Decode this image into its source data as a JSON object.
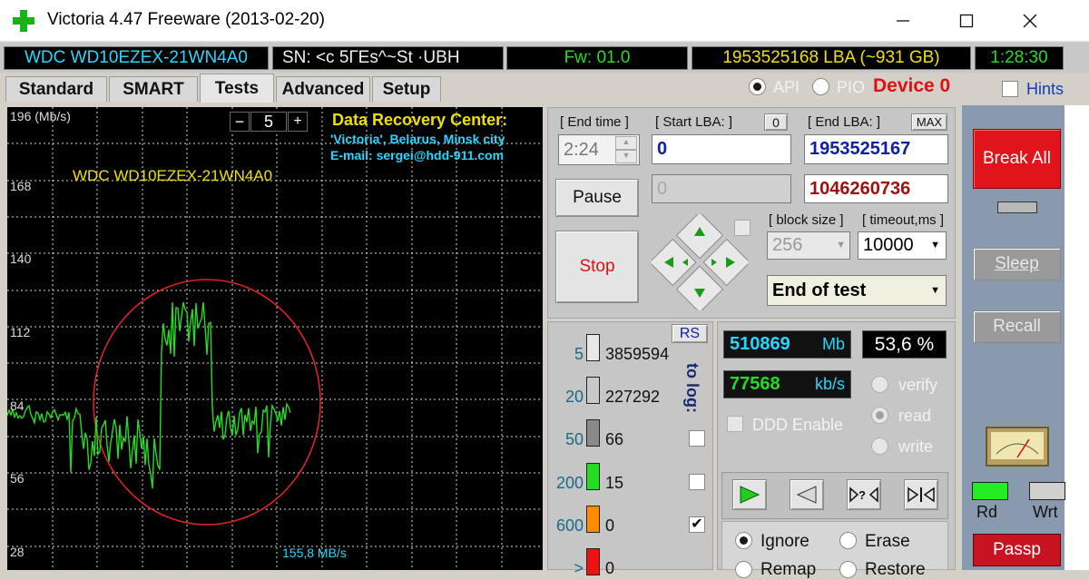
{
  "window": {
    "title": "Victoria 4.47  Freeware (2013-02-20)",
    "controls": [
      "minimize",
      "maximize",
      "close"
    ]
  },
  "info_bar": {
    "model": "WDC WD10EZEX-21WN4A0",
    "serial": "SN: <c  5ГEs^~St    ·UBH",
    "firmware": "Fw: 01.0",
    "lba": "1953525168 LBA (~931 GB)",
    "timer": "1:28:30"
  },
  "tabs": [
    {
      "label": "Standard",
      "active": false
    },
    {
      "label": "SMART",
      "active": false
    },
    {
      "label": "Tests",
      "active": true
    },
    {
      "label": "Advanced",
      "active": false
    },
    {
      "label": "Setup",
      "active": false
    }
  ],
  "mode": {
    "api_label": "API",
    "pio_label": "PIO",
    "selected": "API",
    "device_label": "Device 0",
    "hints_label": "Hints"
  },
  "graph": {
    "y_ticks": [
      "196 (Mb/s)",
      "168",
      "140",
      "112",
      "84",
      "56",
      "28"
    ],
    "scale_minus": "−",
    "scale_value": "5",
    "scale_plus": "+",
    "drive_label": "WDC WD10EZEX-21WN4A0",
    "recovery_title": "Data Recovery Center:",
    "recovery_line1": "'Victoria', Belarus, Minsk city",
    "recovery_line2": "E-mail: sergei@hdd-911.com",
    "speed_readout": "155,8 MB/s",
    "colors": {
      "background": "#000000",
      "grid": "#d8d8d8",
      "trace": "#22dd22",
      "ellipse": "#dd2222"
    }
  },
  "test_controls": {
    "end_time_label": "[ End time ]",
    "end_time_value": "2:24",
    "start_lba_label": "[ Start LBA: ]",
    "start_lba_zero_btn": "0",
    "start_lba_value": "0",
    "end_lba_label": "[ End LBA: ]",
    "end_lba_max_btn": "MAX",
    "end_lba_value": "1953525167",
    "current_lba_disabled": "0",
    "current_lba_value": "1046260736",
    "pause_label": "Pause",
    "stop_label": "Stop",
    "block_size_label": "[ block size ]",
    "block_size_value": "256",
    "timeout_label": "[ timeout,ms ]",
    "timeout_value": "10000",
    "end_action_value": "End of test"
  },
  "stats": {
    "rs_label": "RS",
    "to_log_label": "to log:",
    "rows": [
      {
        "threshold": "5",
        "count": "3859594",
        "color": "#e8e8e8",
        "log": false,
        "has_checkbox": false
      },
      {
        "threshold": "20",
        "count": "227292",
        "color": "#c8c8c8",
        "log": false,
        "has_checkbox": false
      },
      {
        "threshold": "50",
        "count": "66",
        "color": "#8a8a8a",
        "log": false,
        "has_checkbox": true
      },
      {
        "threshold": "200",
        "count": "15",
        "color": "#22dd22",
        "log": false,
        "has_checkbox": true
      },
      {
        "threshold": "600",
        "count": "0",
        "color": "#ff8c00",
        "log": true,
        "has_checkbox": true
      },
      {
        "threshold": ">",
        "count": "0",
        "color": "#ee1111",
        "log": false,
        "has_checkbox": false
      }
    ]
  },
  "progress": {
    "mb_value": "510869",
    "mb_unit": "Mb",
    "percent": "53,6 %",
    "speed_value": "77568",
    "speed_unit": "kb/s",
    "ddd_label": "DDD Enable",
    "verify_label": "verify",
    "read_label": "read",
    "write_label": "write",
    "selected_mode": "read"
  },
  "actions": {
    "ignore_label": "Ignore",
    "erase_label": "Erase",
    "remap_label": "Remap",
    "restore_label": "Restore",
    "selected_action": "Ignore"
  },
  "side": {
    "break_all_label": "Break All",
    "sleep_label": "Sleep",
    "recall_label": "Recall",
    "rd_label": "Rd",
    "wrt_label": "Wrt",
    "passp_label": "Passp"
  }
}
